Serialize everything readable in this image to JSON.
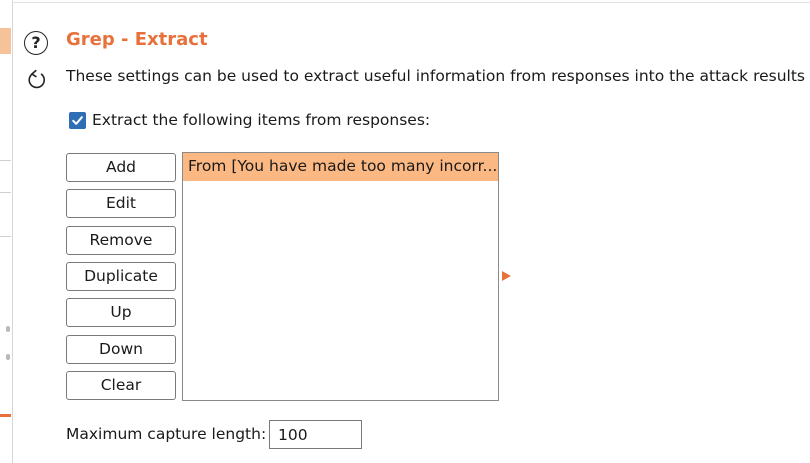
{
  "section": {
    "title": "Grep - Extract",
    "description": "These settings can be used to extract useful information from responses into the attack results table.",
    "help_icon": "question-circle-icon",
    "refresh_icon": "refresh-icon",
    "accent_color": "#e8703a"
  },
  "extract_checkbox": {
    "label": "Extract the following items from responses:",
    "checked": true,
    "color": "#2f6db5"
  },
  "buttons": {
    "add": "Add",
    "edit": "Edit",
    "remove": "Remove",
    "duplicate": "Duplicate",
    "up": "Up",
    "down": "Down",
    "clear": "Clear"
  },
  "extract_list": {
    "items": [
      {
        "label": "From [You have made too many incorr...",
        "selected": true
      }
    ],
    "selected_color": "#fbb882"
  },
  "max_capture": {
    "label": "Maximum capture length:",
    "value": "100"
  }
}
